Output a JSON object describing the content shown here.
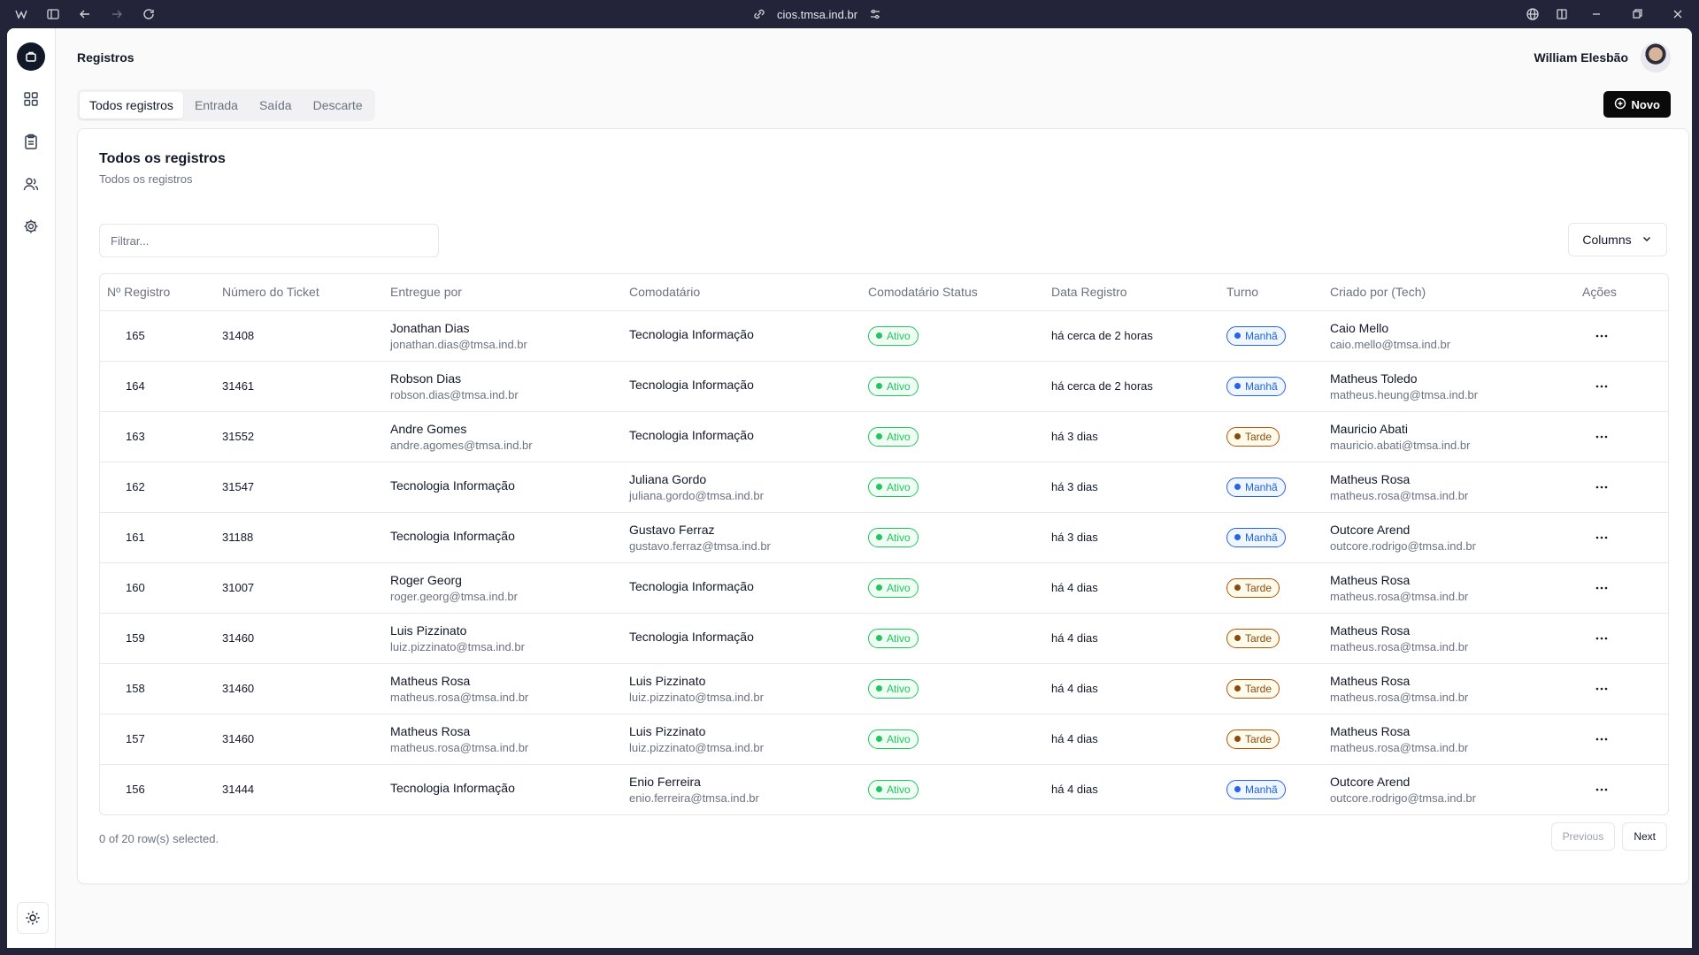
{
  "browser": {
    "url": "cios.tmsa.ind.br"
  },
  "header": {
    "title": "Registros",
    "user_name": "William Elesbão"
  },
  "tabs": [
    {
      "label": "Todos registros",
      "active": true
    },
    {
      "label": "Entrada",
      "active": false
    },
    {
      "label": "Saída",
      "active": false
    },
    {
      "label": "Descarte",
      "active": false
    }
  ],
  "new_button": {
    "label": "Novo"
  },
  "card": {
    "title": "Todos os registros",
    "subtitle": "Todos os registros"
  },
  "filter": {
    "placeholder": "Filtrar...",
    "value": ""
  },
  "columns_button": {
    "label": "Columns"
  },
  "table": {
    "headers": [
      "Nº Registro",
      "Número do Ticket",
      "Entregue por",
      "Comodatário",
      "Comodatário Status",
      "Data Registro",
      "Turno",
      "Criado por (Tech)",
      "Ações"
    ],
    "rows": [
      {
        "registro": "165",
        "ticket": "31408",
        "entregue": {
          "name": "Jonathan Dias",
          "email": "jonathan.dias@tmsa.ind.br"
        },
        "comodatario": {
          "name": "Tecnologia Informação",
          "email": ""
        },
        "status": "Ativo",
        "data": "há cerca de 2 horas",
        "turno": "Manhã",
        "criado": {
          "name": "Caio Mello",
          "email": "caio.mello@tmsa.ind.br"
        }
      },
      {
        "registro": "164",
        "ticket": "31461",
        "entregue": {
          "name": "Robson Dias",
          "email": "robson.dias@tmsa.ind.br"
        },
        "comodatario": {
          "name": "Tecnologia Informação",
          "email": ""
        },
        "status": "Ativo",
        "data": "há cerca de 2 horas",
        "turno": "Manhã",
        "criado": {
          "name": "Matheus Toledo",
          "email": "matheus.heung@tmsa.ind.br"
        }
      },
      {
        "registro": "163",
        "ticket": "31552",
        "entregue": {
          "name": "Andre Gomes",
          "email": "andre.agomes@tmsa.ind.br"
        },
        "comodatario": {
          "name": "Tecnologia Informação",
          "email": ""
        },
        "status": "Ativo",
        "data": "há 3 dias",
        "turno": "Tarde",
        "criado": {
          "name": "Mauricio Abati",
          "email": "mauricio.abati@tmsa.ind.br"
        }
      },
      {
        "registro": "162",
        "ticket": "31547",
        "entregue": {
          "name": "Tecnologia Informação",
          "email": ""
        },
        "comodatario": {
          "name": "Juliana Gordo",
          "email": "juliana.gordo@tmsa.ind.br"
        },
        "status": "Ativo",
        "data": "há 3 dias",
        "turno": "Manhã",
        "criado": {
          "name": "Matheus Rosa",
          "email": "matheus.rosa@tmsa.ind.br"
        }
      },
      {
        "registro": "161",
        "ticket": "31188",
        "entregue": {
          "name": "Tecnologia Informação",
          "email": ""
        },
        "comodatario": {
          "name": "Gustavo Ferraz",
          "email": "gustavo.ferraz@tmsa.ind.br"
        },
        "status": "Ativo",
        "data": "há 3 dias",
        "turno": "Manhã",
        "criado": {
          "name": "Outcore Arend",
          "email": "outcore.rodrigo@tmsa.ind.br"
        }
      },
      {
        "registro": "160",
        "ticket": "31007",
        "entregue": {
          "name": "Roger Georg",
          "email": "roger.georg@tmsa.ind.br"
        },
        "comodatario": {
          "name": "Tecnologia Informação",
          "email": ""
        },
        "status": "Ativo",
        "data": "há 4 dias",
        "turno": "Tarde",
        "criado": {
          "name": "Matheus Rosa",
          "email": "matheus.rosa@tmsa.ind.br"
        }
      },
      {
        "registro": "159",
        "ticket": "31460",
        "entregue": {
          "name": "Luis Pizzinato",
          "email": "luiz.pizzinato@tmsa.ind.br"
        },
        "comodatario": {
          "name": "Tecnologia Informação",
          "email": ""
        },
        "status": "Ativo",
        "data": "há 4 dias",
        "turno": "Tarde",
        "criado": {
          "name": "Matheus Rosa",
          "email": "matheus.rosa@tmsa.ind.br"
        }
      },
      {
        "registro": "158",
        "ticket": "31460",
        "entregue": {
          "name": "Matheus Rosa",
          "email": "matheus.rosa@tmsa.ind.br"
        },
        "comodatario": {
          "name": "Luis Pizzinato",
          "email": "luiz.pizzinato@tmsa.ind.br"
        },
        "status": "Ativo",
        "data": "há 4 dias",
        "turno": "Tarde",
        "criado": {
          "name": "Matheus Rosa",
          "email": "matheus.rosa@tmsa.ind.br"
        }
      },
      {
        "registro": "157",
        "ticket": "31460",
        "entregue": {
          "name": "Matheus Rosa",
          "email": "matheus.rosa@tmsa.ind.br"
        },
        "comodatario": {
          "name": "Luis Pizzinato",
          "email": "luiz.pizzinato@tmsa.ind.br"
        },
        "status": "Ativo",
        "data": "há 4 dias",
        "turno": "Tarde",
        "criado": {
          "name": "Matheus Rosa",
          "email": "matheus.rosa@tmsa.ind.br"
        }
      },
      {
        "registro": "156",
        "ticket": "31444",
        "entregue": {
          "name": "Tecnologia Informação",
          "email": ""
        },
        "comodatario": {
          "name": "Enio Ferreira",
          "email": "enio.ferreira@tmsa.ind.br"
        },
        "status": "Ativo",
        "data": "há 4 dias",
        "turno": "Manhã",
        "criado": {
          "name": "Outcore Arend",
          "email": "outcore.rodrigo@tmsa.ind.br"
        }
      }
    ]
  },
  "footer": {
    "selection": "0 of 20 row(s) selected.",
    "previous_label": "Previous",
    "next_label": "Next"
  },
  "colors": {
    "status_ativo": "#22c55e",
    "turno_manha": "#2563eb",
    "turno_tarde": "#b45309",
    "primary_button": "#0a0a0a"
  }
}
